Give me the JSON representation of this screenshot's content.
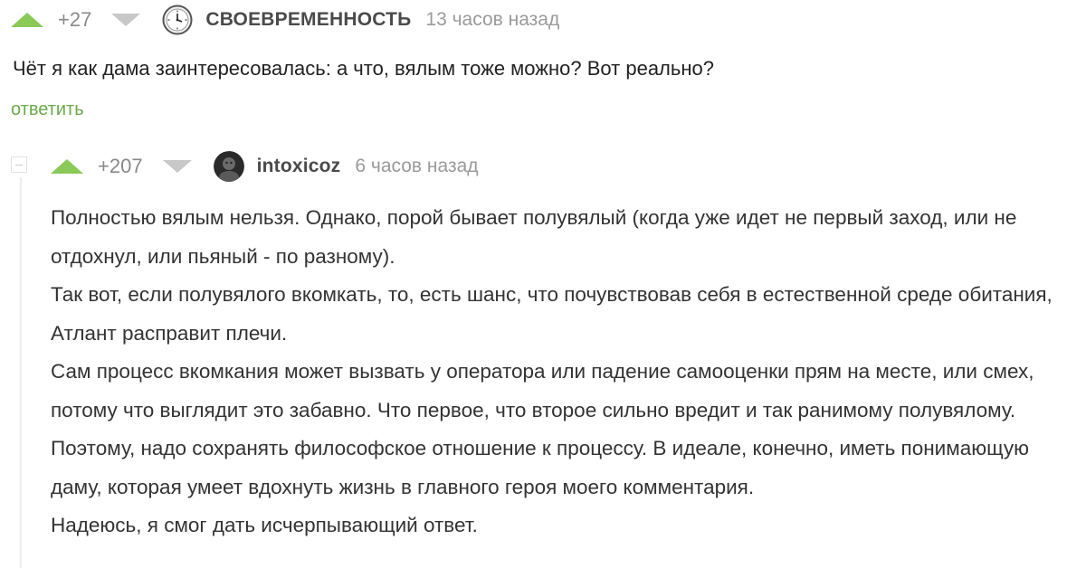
{
  "comment1": {
    "rating": "+27",
    "author": "СВОЕВРЕМЕННОСТЬ",
    "time": "13 часов назад",
    "text": "Чёт я как дама заинтересовалась: а что, вялым тоже можно? Вот реально?",
    "reply_label": "ответить",
    "avatar_icon": "clock-icon"
  },
  "comment2": {
    "rating": "+207",
    "author": "intoxicoz",
    "time": "6 часов назад",
    "avatar_icon": "user-avatar",
    "paragraphs": [
      "Полностью вялым нельзя. Однако, порой бывает полувялый (когда уже идет не первый заход, или не отдохнул, или пьяный - по разному).",
      "Так вот, если полувялого вкомкать, то, есть шанс, что почувствовав себя в естественной среде обитания, Атлант расправит плечи.",
      "Сам процесс вкомкания может вызвать у оператора или падение самооценки прям на месте, или смех, потому что выглядит это забавно. Что первое, что второе сильно вредит и так ранимому полувялому. Поэтому, надо сохранять философское отношение к процессу. В идеале, конечно, иметь понимающую даму, которая умеет вдохнуть жизнь в главного героя моего комментария.",
      "Надеюсь, я смог дать исчерпывающий ответ."
    ]
  },
  "colors": {
    "upvote": "#8ac858",
    "downvote": "#c8c8c8",
    "reply_link": "#6aaa4a"
  }
}
